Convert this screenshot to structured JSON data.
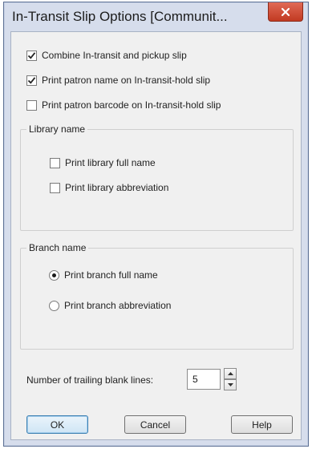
{
  "window": {
    "title": "In-Transit Slip Options [Communit...",
    "close_icon": "close-x-icon"
  },
  "options": [
    {
      "label": "Combine In-transit and pickup slip",
      "checked": true
    },
    {
      "label": "Print patron name on In-transit-hold slip",
      "checked": true
    },
    {
      "label": "Print patron barcode on In-transit-hold slip",
      "checked": false
    }
  ],
  "library_name_group": {
    "title": "Library name",
    "items": [
      {
        "label": "Print library full name",
        "checked": false
      },
      {
        "label": "Print library abbreviation",
        "checked": false
      }
    ]
  },
  "branch_name_group": {
    "title": "Branch name",
    "items": [
      {
        "label": "Print branch full name",
        "selected": true
      },
      {
        "label": "Print branch abbreviation",
        "selected": false
      }
    ]
  },
  "trailing_lines": {
    "label": "Number of trailing blank lines:",
    "value": "5"
  },
  "buttons": {
    "ok": "OK",
    "cancel": "Cancel",
    "help": "Help"
  },
  "colors": {
    "frame": "#d6ddec",
    "close_button": "#c23a22",
    "client_bg": "#f0f0f0"
  }
}
